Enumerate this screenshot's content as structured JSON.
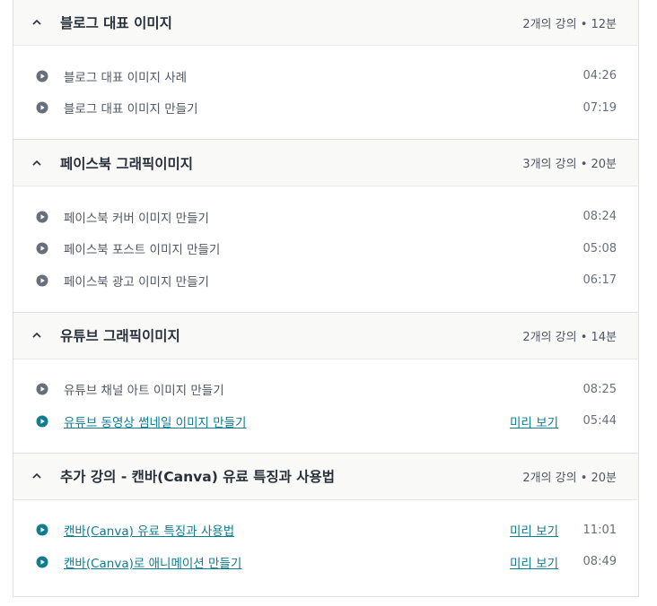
{
  "sections": [
    {
      "title": "블로그 대표 이미지",
      "meta": "2개의 강의 • 12분",
      "lectures": [
        {
          "title": "블로그 대표 이미지 사례",
          "duration": "04:26",
          "preview": ""
        },
        {
          "title": "블로그 대표 이미지 만들기",
          "duration": "07:19",
          "preview": ""
        }
      ]
    },
    {
      "title": "페이스북 그래픽이미지",
      "meta": "3개의 강의 • 20분",
      "lectures": [
        {
          "title": "페이스북 커버 이미지 만들기",
          "duration": "08:24",
          "preview": ""
        },
        {
          "title": "페이스북 포스트 이미지 만들기",
          "duration": "05:08",
          "preview": ""
        },
        {
          "title": "페이스북 광고 이미지 만들기",
          "duration": "06:17",
          "preview": ""
        }
      ]
    },
    {
      "title": "유튜브 그래픽이미지",
      "meta": "2개의 강의 • 14분",
      "lectures": [
        {
          "title": "유튜브 채널 아트 이미지 만들기",
          "duration": "08:25",
          "preview": ""
        },
        {
          "title": "유튜브 동영상 썸네일 이미지 만들기",
          "duration": "05:44",
          "preview": "미리 보기"
        }
      ]
    },
    {
      "title": "추가 강의 - 캔바(Canva) 유료 특징과 사용법",
      "meta": "2개의 강의 • 20분",
      "lectures": [
        {
          "title": "캔바(Canva) 유료 특징과 사용법",
          "duration": "11:01",
          "preview": "미리 보기"
        },
        {
          "title": "캔바(Canva)로 애니메이션 만들기",
          "duration": "08:49",
          "preview": "미리 보기"
        }
      ]
    }
  ],
  "icons": {
    "section_toggle": "chevron-up-icon",
    "lecture": "play-icon"
  },
  "colors": {
    "play_default": "#686f7a",
    "play_preview": "#0f7c90",
    "link": "#0f7c90"
  }
}
